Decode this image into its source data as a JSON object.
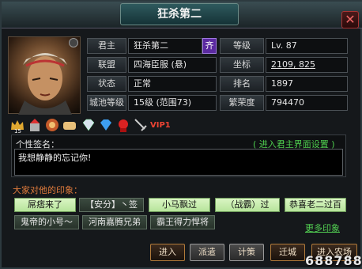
{
  "window": {
    "title": "狂杀第二",
    "close_icon": "close-icon"
  },
  "profile": {
    "rows": [
      {
        "label": "君主",
        "value": "狂杀第二",
        "badge": "齐"
      },
      {
        "label": "等级",
        "value": "Lv. 87"
      },
      {
        "label": "联盟",
        "value": "四海臣服 (悬)"
      },
      {
        "label": "坐标",
        "value": "2109, 825"
      },
      {
        "label": "状态",
        "value": "正常"
      },
      {
        "label": "排名",
        "value": "1897"
      },
      {
        "label": "城池等级",
        "value": "15级 (范围73)"
      },
      {
        "label": "繁荣度",
        "value": "794470"
      }
    ]
  },
  "badges": {
    "vip": "VIP1",
    "level_num": "15"
  },
  "signature": {
    "heading": "个性签名：",
    "link": "( 进入君主界面设置 )",
    "text": "我想静静的忘记你!"
  },
  "impressions": {
    "heading": "大家对他的印象：",
    "tags_row1": [
      "屌痞来了",
      "【安分】丶签",
      "小马飘过",
      "（战霸）过",
      "恭喜老二过百"
    ],
    "tags_row2": [
      "鬼帝的小号～",
      "河南嘉腾兄弟",
      "霸王得力悍将"
    ],
    "more": "更多印象"
  },
  "buttons": {
    "enter": "进入",
    "dispatch": "派遣",
    "plan": "计策",
    "move": "迁城",
    "enter_farm": "进入农场"
  },
  "watermark": "688788",
  "colors": {
    "accent_green": "#4fcf4f",
    "accent_orange": "#e07b3c",
    "badge_purple": "#5b2aa0"
  }
}
